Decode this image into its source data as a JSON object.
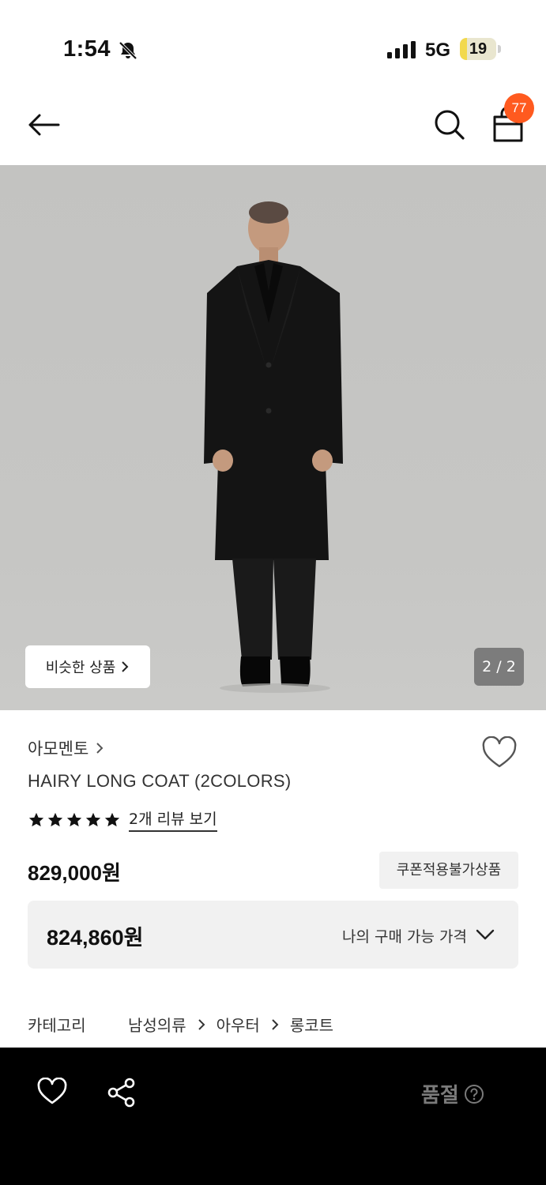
{
  "status_bar": {
    "time": "1:54",
    "network": "5G",
    "battery": "19",
    "battery_level_percent": 19,
    "icons": [
      "bell-slash-icon",
      "signal-icon",
      "battery-icon"
    ]
  },
  "header": {
    "cart_badge": "77",
    "icons": [
      "back-arrow-icon",
      "search-icon",
      "shopping-bag-icon"
    ]
  },
  "gallery": {
    "similar_label": "비슷한 상품",
    "page_indicator": "2 / 2"
  },
  "product": {
    "brand": "아모멘토",
    "name": "HAIRY LONG COAT (2COLORS)",
    "rating_stars": 5,
    "review_link": "2개 리뷰 보기",
    "price": "829,000원",
    "coupon_badge": "쿠폰적용불가상품",
    "my_price": "824,860원",
    "my_price_label": "나의 구매 가능 가격"
  },
  "category": {
    "label": "카테고리",
    "path": [
      "남성의류",
      "아우터",
      "롱코트"
    ]
  },
  "bottom_bar": {
    "status_label": "품절",
    "icons": [
      "heart-icon",
      "share-icon",
      "help-circle-icon"
    ]
  },
  "colors": {
    "badge": "#ff5a1f",
    "bottom_bar": "#000000",
    "muted_text": "#7a7a7a",
    "panel": "#f1f1f1"
  }
}
